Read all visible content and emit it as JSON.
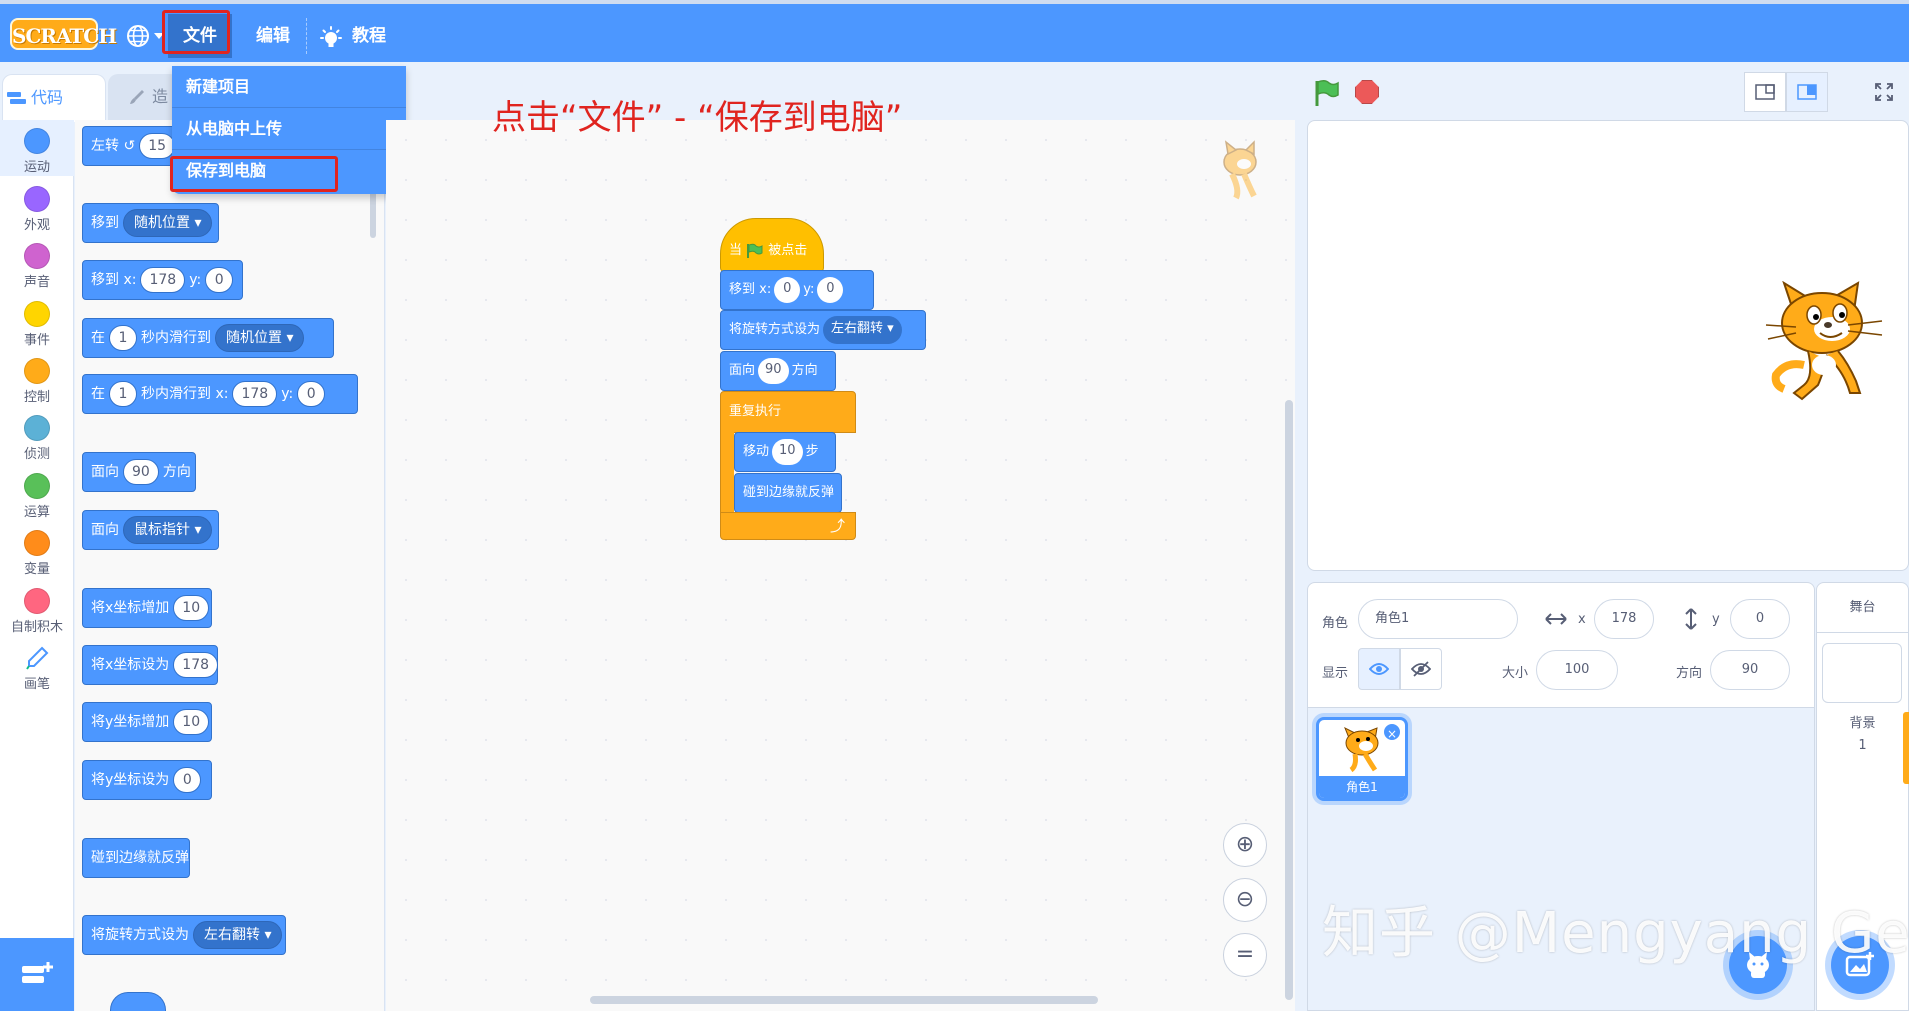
{
  "menubar": {
    "logo": "SCRATCH",
    "file": "文件",
    "edit": "编辑",
    "tutorials": "教程"
  },
  "file_dropdown": {
    "items": [
      "新建项目",
      "从电脑中上传",
      "保存到电脑"
    ]
  },
  "instruction": "点击“文件” - “保存到电脑”",
  "tabs": {
    "code": "代码",
    "costumes": "造"
  },
  "categories": [
    {
      "label": "运动",
      "color": "#4c97ff"
    },
    {
      "label": "外观",
      "color": "#9966ff"
    },
    {
      "label": "声音",
      "color": "#cf63cf"
    },
    {
      "label": "事件",
      "color": "#ffd500"
    },
    {
      "label": "控制",
      "color": "#ffab19"
    },
    {
      "label": "侦测",
      "color": "#5cb1d6"
    },
    {
      "label": "运算",
      "color": "#59c059"
    },
    {
      "label": "变量",
      "color": "#ff8c1a"
    },
    {
      "label": "自制积木",
      "color": "#ff6680"
    },
    {
      "label": "画笔",
      "color": "#0fbd8c"
    }
  ],
  "palette": {
    "turn_left": {
      "label": "左转",
      "value": "15"
    },
    "goto": {
      "label": "移到",
      "menu": "随机位置"
    },
    "goto_xy": {
      "label": "移到 x:",
      "x": "178",
      "ylabel": "y:",
      "y": "0"
    },
    "glide": {
      "pre": "在",
      "secs": "1",
      "mid": "秒内滑行到",
      "menu": "随机位置"
    },
    "glide_xy": {
      "pre": "在",
      "secs": "1",
      "mid": "秒内滑行到 x:",
      "x": "178",
      "ylabel": "y:",
      "y": "0"
    },
    "point_dir": {
      "pre": "面向",
      "value": "90",
      "post": "方向"
    },
    "point_towards": {
      "pre": "面向",
      "menu": "鼠标指针"
    },
    "change_x": {
      "label": "将x坐标增加",
      "value": "10"
    },
    "set_x": {
      "label": "将x坐标设为",
      "value": "178"
    },
    "change_y": {
      "label": "将y坐标增加",
      "value": "10"
    },
    "set_y": {
      "label": "将y坐标设为",
      "value": "0"
    },
    "bounce": {
      "label": "碰到边缘就反弹"
    },
    "rotation_style": {
      "label": "将旋转方式设为",
      "menu": "左右翻转"
    }
  },
  "script": {
    "hat": {
      "pre": "当",
      "post": "被点击"
    },
    "goto_xy": {
      "label": "移到 x:",
      "x": "0",
      "ylabel": "y:",
      "y": "0"
    },
    "rotation": {
      "label": "将旋转方式设为",
      "menu": "左右翻转"
    },
    "point": {
      "pre": "面向",
      "value": "90",
      "post": "方向"
    },
    "forever": {
      "label": "重复执行"
    },
    "move": {
      "pre": "移动",
      "value": "10",
      "post": "步"
    },
    "bounce": {
      "label": "碰到边缘就反弹"
    }
  },
  "sprite_info": {
    "sprite_label": "角色",
    "sprite_name": "角色1",
    "x_label": "x",
    "x_value": "178",
    "y_label": "y",
    "y_value": "0",
    "show_label": "显示",
    "size_label": "大小",
    "size_value": "100",
    "direction_label": "方向",
    "direction_value": "90"
  },
  "sprite_list": {
    "items": [
      {
        "name": "角色1"
      }
    ]
  },
  "stage_panel": {
    "title": "舞台",
    "backdrop_label": "背景",
    "backdrop_count": "1"
  },
  "watermark": "知乎 @Mengyang Ge"
}
